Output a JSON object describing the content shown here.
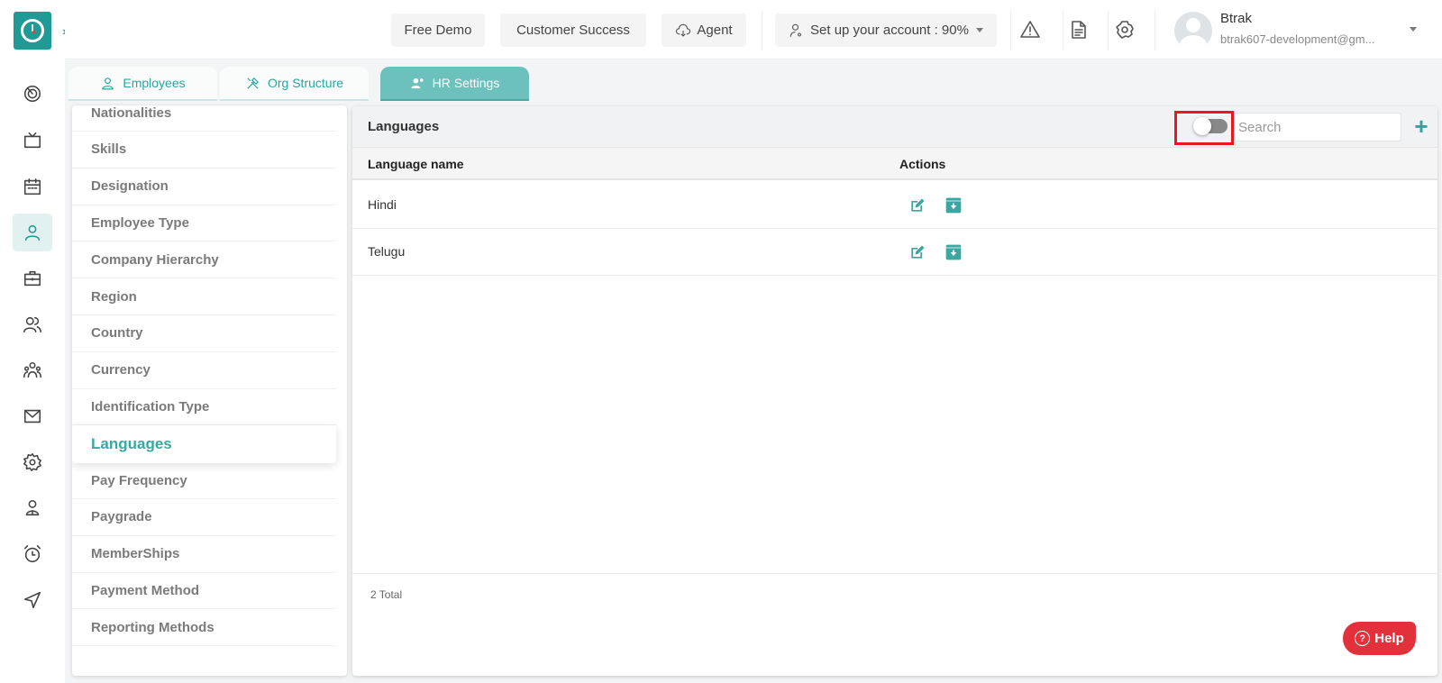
{
  "app": {
    "name": "Btrak",
    "brand_color": "#1f9a95",
    "accent_color": "#2aa69f"
  },
  "topbar": {
    "free_demo": "Free Demo",
    "customer_success": "Customer Success",
    "agent": "Agent",
    "setup_account": "Set up your account : 90%",
    "setup_progress_percent": 90,
    "user": {
      "name": "Btrak",
      "email": "btrak607-development@gm..."
    }
  },
  "rail": {
    "items": [
      {
        "icon": "dashboard-icon"
      },
      {
        "icon": "tv-icon"
      },
      {
        "icon": "calendar-icon"
      },
      {
        "icon": "user-icon",
        "active": true
      },
      {
        "icon": "briefcase-icon"
      },
      {
        "icon": "users-icon"
      },
      {
        "icon": "team-icon"
      },
      {
        "icon": "mail-icon"
      },
      {
        "icon": "settings-icon"
      },
      {
        "icon": "profile-icon"
      },
      {
        "icon": "alarm-icon"
      },
      {
        "icon": "send-icon"
      }
    ]
  },
  "tabs": [
    {
      "label": "Employees",
      "icon": "user-icon"
    },
    {
      "label": "Org Structure",
      "icon": "tools-icon"
    },
    {
      "label": "HR Settings",
      "icon": "user-settings-icon",
      "active": true
    }
  ],
  "settings_list": {
    "items": [
      "Nationalities",
      "Skills",
      "Designation",
      "Employee Type",
      "Company Hierarchy",
      "Region",
      "Country",
      "Currency",
      "Identification Type",
      "Languages",
      "Pay Frequency",
      "Paygrade",
      "MemberShips",
      "Payment Method",
      "Reporting Methods"
    ],
    "active": "Languages"
  },
  "panel": {
    "title": "Languages",
    "toggle_on": false,
    "search_placeholder": "Search",
    "search_value": "",
    "columns": [
      "Language name",
      "Actions"
    ],
    "rows": [
      {
        "name": "Hindi"
      },
      {
        "name": "Telugu"
      }
    ],
    "total_label": "2 Total"
  },
  "help": {
    "label": "Help",
    "color": "#e2313a"
  }
}
